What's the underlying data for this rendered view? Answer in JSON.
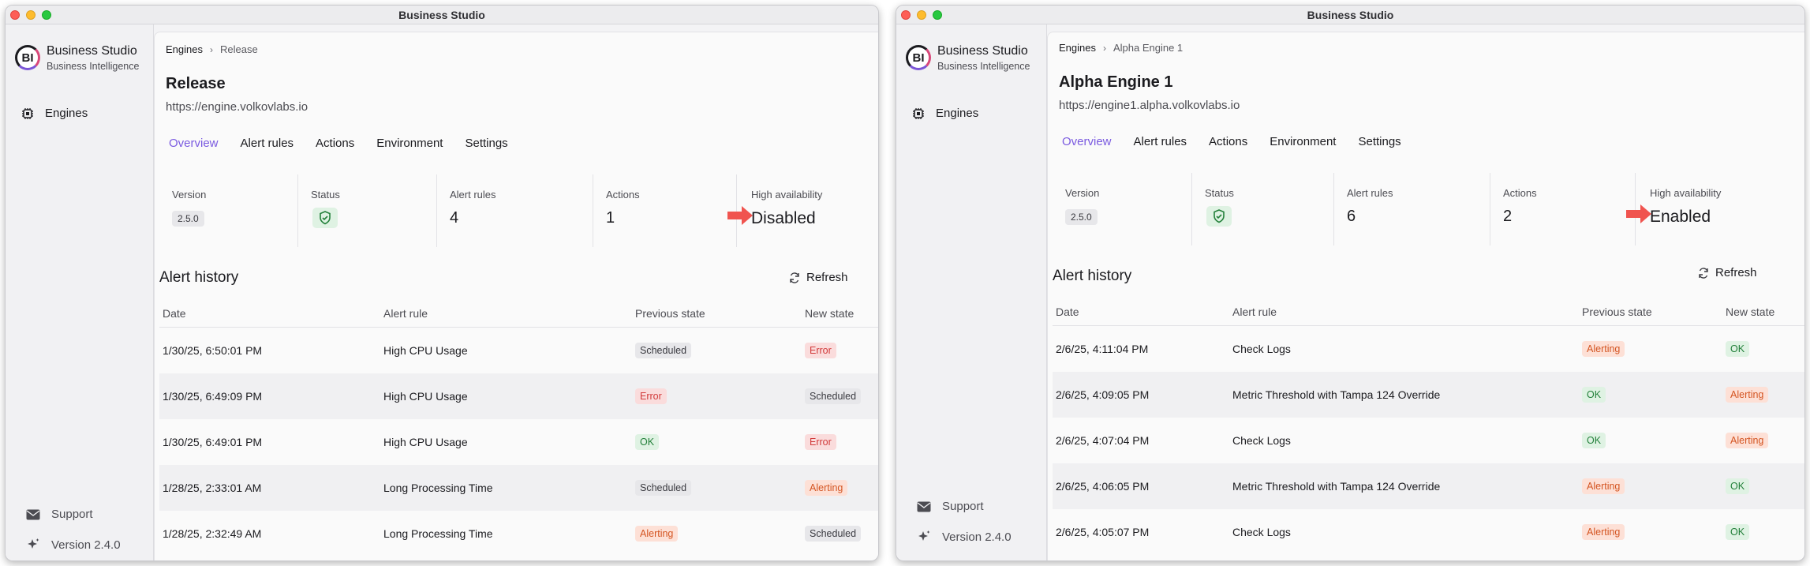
{
  "app_title": "Business Studio",
  "brand": {
    "title": "Business Studio",
    "subtitle": "Business Intelligence",
    "logo_text": "BI"
  },
  "nav": {
    "engines": "Engines"
  },
  "footer": {
    "support": "Support",
    "version": "Version 2.4.0"
  },
  "tabs": [
    "Overview",
    "Alert rules",
    "Actions",
    "Environment",
    "Settings"
  ],
  "stat_labels": {
    "version": "Version",
    "status": "Status",
    "alert_rules": "Alert rules",
    "actions": "Actions",
    "ha": "High availability"
  },
  "section_title": "Alert history",
  "refresh_label": "Refresh",
  "columns": [
    "Date",
    "Alert rule",
    "Previous state",
    "New state"
  ],
  "colors": {
    "accent": "#7a5ae0",
    "ok": "#23803a",
    "error": "#d13a3a",
    "alerting": "#d45522",
    "arrow": "#f0544f"
  },
  "left": {
    "breadcrumb": {
      "root": "Engines",
      "current": "Release"
    },
    "title": "Release",
    "url": "https://engine.volkovlabs.io",
    "version": "2.5.0",
    "alert_rules_count": "4",
    "actions_count": "1",
    "ha": "Disabled",
    "rows": [
      {
        "date": "1/30/25, 6:50:01 PM",
        "rule": "High CPU Usage",
        "prev": "Scheduled",
        "next": "Error"
      },
      {
        "date": "1/30/25, 6:49:09 PM",
        "rule": "High CPU Usage",
        "prev": "Error",
        "next": "Scheduled"
      },
      {
        "date": "1/30/25, 6:49:01 PM",
        "rule": "High CPU Usage",
        "prev": "OK",
        "next": "Error"
      },
      {
        "date": "1/28/25, 2:33:01 AM",
        "rule": "Long Processing Time",
        "prev": "Scheduled",
        "next": "Alerting"
      },
      {
        "date": "1/28/25, 2:32:49 AM",
        "rule": "Long Processing Time",
        "prev": "Alerting",
        "next": "Scheduled"
      }
    ]
  },
  "right": {
    "breadcrumb": {
      "root": "Engines",
      "current": "Alpha Engine 1"
    },
    "title": "Alpha Engine 1",
    "url": "https://engine1.alpha.volkovlabs.io",
    "version": "2.5.0",
    "alert_rules_count": "6",
    "actions_count": "2",
    "ha": "Enabled",
    "rows": [
      {
        "date": "2/6/25, 4:11:04 PM",
        "rule": "Check Logs",
        "prev": "Alerting",
        "next": "OK"
      },
      {
        "date": "2/6/25, 4:09:05 PM",
        "rule": "Metric Threshold with Tampa 124 Override",
        "prev": "OK",
        "next": "Alerting"
      },
      {
        "date": "2/6/25, 4:07:04 PM",
        "rule": "Check Logs",
        "prev": "OK",
        "next": "Alerting"
      },
      {
        "date": "2/6/25, 4:06:05 PM",
        "rule": "Metric Threshold with Tampa 124 Override",
        "prev": "Alerting",
        "next": "OK"
      },
      {
        "date": "2/6/25, 4:05:07 PM",
        "rule": "Check Logs",
        "prev": "Alerting",
        "next": "OK"
      }
    ]
  }
}
